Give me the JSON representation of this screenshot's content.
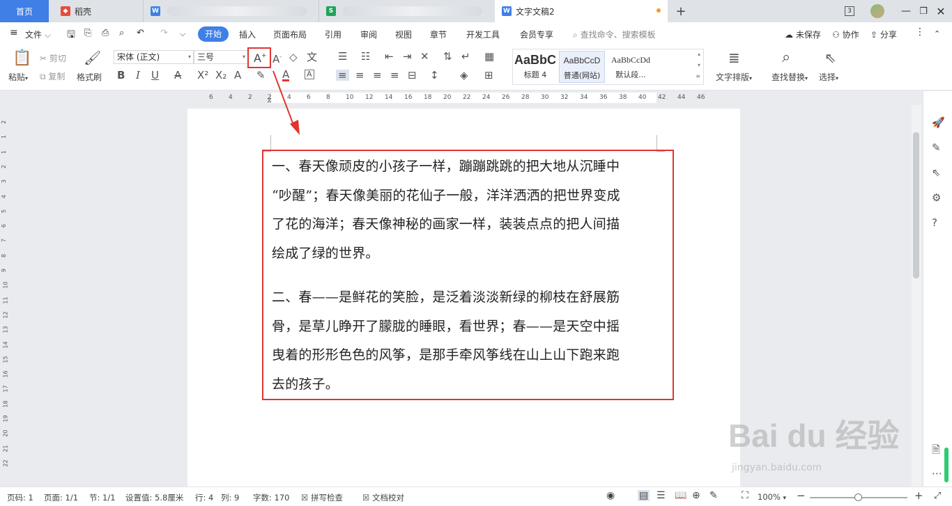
{
  "tabs": {
    "home": "首页",
    "daoke": "稻壳",
    "document": "文字文稿2",
    "add": "+"
  },
  "window": {
    "count_badge": "3"
  },
  "menu": {
    "file": "文件",
    "items": [
      "开始",
      "插入",
      "页面布局",
      "引用",
      "审阅",
      "视图",
      "章节",
      "开发工具",
      "会员专享"
    ],
    "search": "查找命令、搜索模板",
    "unsaved": "未保存",
    "collab": "协作",
    "share": "分享"
  },
  "toolbar": {
    "paste": "粘贴",
    "cut": "剪切",
    "copy": "复制",
    "format_painter": "格式刷",
    "font_name": "宋体 (正文)",
    "font_size": "三号",
    "styles": [
      {
        "preview": "AaBbC",
        "name": "标题 4"
      },
      {
        "preview": "AaBbCcD",
        "name": "普通(网站)"
      },
      {
        "preview": "AaBbCcDd",
        "name": "默认段..."
      }
    ],
    "text_layout": "文字排版",
    "find_replace": "查找替换",
    "select": "选择"
  },
  "ruler": {
    "h_numbers": [
      "6",
      "4",
      "2",
      "2",
      "4",
      "6",
      "8",
      "10",
      "12",
      "14",
      "16",
      "18",
      "20",
      "22",
      "24",
      "26",
      "28",
      "30",
      "32",
      "34",
      "36",
      "38",
      "40",
      "42",
      "44",
      "46"
    ],
    "v_numbers": [
      "2",
      "1",
      "1",
      "2",
      "3",
      "4",
      "5",
      "6",
      "7",
      "8",
      "9",
      "10",
      "11",
      "12",
      "13",
      "14",
      "15",
      "16",
      "17",
      "18",
      "19",
      "20",
      "21",
      "22"
    ]
  },
  "document": {
    "paragraphs": [
      [
        "一、春天像顽皮的小孩子一样，蹦蹦跳跳的把大地从沉睡中",
        "“吵醒”；春天像美丽的花仙子一般，洋洋洒洒的把世界变成",
        "了花的海洋；春天像神秘的画家一样，装装点点的把人间描",
        "绘成了绿的世界。"
      ],
      [
        "二、春——是鲜花的笑脸，是泛着淡淡新绿的柳枝在舒展筋",
        "骨，是草儿睁开了朦胧的睡眼，看世界；春——是天空中摇",
        "曳着的形形色色的风筝，是那手牵风筝线在山上山下跑来跑",
        "去的孩子。"
      ]
    ]
  },
  "status": {
    "page_num": "页码: 1",
    "pages": "页面: 1/1",
    "section": "节: 1/1",
    "setting": "设置值: 5.8厘米",
    "row": "行: 4",
    "col": "列: 9",
    "words": "字数: 170",
    "spellcheck": "拼写检查",
    "proofread": "文档校对",
    "zoom": "100%"
  },
  "watermark": {
    "main": "Bai du 经验",
    "sub": "jingyan.baidu.com"
  }
}
